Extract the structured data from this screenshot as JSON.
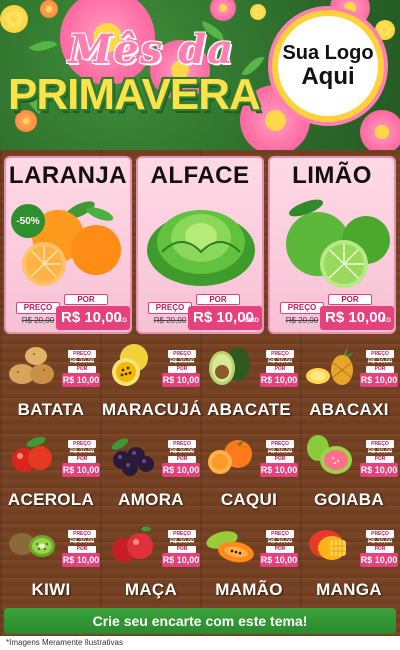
{
  "header": {
    "title_line1": "Mês da",
    "title_line2": "PRIMAVERA",
    "logo_line1": "Sua Logo",
    "logo_line2": "Aqui"
  },
  "colors": {
    "green": "#2e7d32",
    "pink": "#e5417d",
    "yellow": "#ffe24a",
    "wood": "#6b3b1f"
  },
  "big_products": [
    {
      "name": "LARANJA",
      "discount": "-50%",
      "price_label": "PREÇO",
      "old_price": "R$ 20,00",
      "por": "POR",
      "new_price": "R$ 10,00",
      "unit": "KG",
      "icon": "orange-icon"
    },
    {
      "name": "ALFACE",
      "price_label": "PREÇO",
      "old_price": "R$ 20,00",
      "por": "POR",
      "new_price": "R$ 10,00",
      "unit": "UNID",
      "icon": "lettuce-icon"
    },
    {
      "name": "LIMÃO",
      "price_label": "PREÇO",
      "old_price": "R$ 20,00",
      "por": "POR",
      "new_price": "R$ 10,00",
      "unit": "KG",
      "icon": "lime-icon"
    }
  ],
  "small_products": [
    {
      "name": "BATATA",
      "price_label": "PREÇO",
      "old_price": "R$ 20,00",
      "por": "POR",
      "new_price": "R$ 10,00",
      "icon": "potato-icon"
    },
    {
      "name": "MARACUJÁ",
      "price_label": "PREÇO",
      "old_price": "R$ 20,00",
      "por": "POR",
      "new_price": "R$ 10,00",
      "icon": "passion-fruit-icon"
    },
    {
      "name": "ABACATE",
      "price_label": "PREÇO",
      "old_price": "R$ 20,00",
      "por": "POR",
      "new_price": "R$ 10,00",
      "icon": "avocado-icon"
    },
    {
      "name": "ABACAXI",
      "price_label": "PREÇO",
      "old_price": "R$ 20,00",
      "por": "POR",
      "new_price": "R$ 10,00",
      "icon": "pineapple-icon"
    },
    {
      "name": "ACEROLA",
      "price_label": "PREÇO",
      "old_price": "R$ 20,00",
      "por": "POR",
      "new_price": "R$ 10,00",
      "icon": "acerola-icon"
    },
    {
      "name": "AMORA",
      "price_label": "PREÇO",
      "old_price": "R$ 20,00",
      "por": "POR",
      "new_price": "R$ 10,00",
      "icon": "blackberry-icon"
    },
    {
      "name": "CAQUI",
      "price_label": "PREÇO",
      "old_price": "R$ 20,00",
      "por": "POR",
      "new_price": "R$ 10,00",
      "icon": "persimmon-icon"
    },
    {
      "name": "GOIABA",
      "price_label": "PREÇO",
      "old_price": "R$ 20,00",
      "por": "POR",
      "new_price": "R$ 10,00",
      "icon": "guava-icon"
    },
    {
      "name": "KIWI",
      "price_label": "PREÇO",
      "old_price": "R$ 20,00",
      "por": "POR",
      "new_price": "R$ 10,00",
      "icon": "kiwi-icon"
    },
    {
      "name": "MAÇA",
      "price_label": "PREÇO",
      "old_price": "R$ 20,00",
      "por": "POR",
      "new_price": "R$ 10,00",
      "icon": "apple-icon"
    },
    {
      "name": "MAMÃO",
      "price_label": "PREÇO",
      "old_price": "R$ 20,00",
      "por": "POR",
      "new_price": "R$ 10,00",
      "icon": "papaya-icon"
    },
    {
      "name": "MANGA",
      "price_label": "PREÇO",
      "old_price": "R$ 20,00",
      "por": "POR",
      "new_price": "R$ 10,00",
      "icon": "mango-icon"
    }
  ],
  "footer": {
    "cta": "Crie seu encarte com este tema!",
    "disclaimer": "*Imagens Meramente Ilustrativas"
  }
}
